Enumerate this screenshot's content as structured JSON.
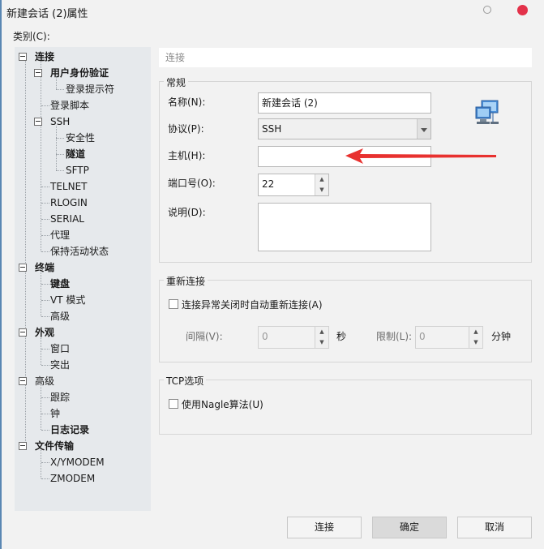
{
  "window": {
    "title": "新建会话 (2)属性"
  },
  "category_label": "类别(C):",
  "tree": [
    {
      "label": "连接",
      "bold": true,
      "level": 0,
      "expander": true
    },
    {
      "label": "用户身份验证",
      "bold": true,
      "level": 1,
      "expander": true
    },
    {
      "label": "登录提示符",
      "bold": false,
      "level": 2,
      "expander": false
    },
    {
      "label": "登录脚本",
      "bold": false,
      "level": 1,
      "expander": false
    },
    {
      "label": "SSH",
      "bold": false,
      "level": 1,
      "expander": true
    },
    {
      "label": "安全性",
      "bold": false,
      "level": 2,
      "expander": false
    },
    {
      "label": "隧道",
      "bold": true,
      "level": 2,
      "expander": false
    },
    {
      "label": "SFTP",
      "bold": false,
      "level": 2,
      "expander": false
    },
    {
      "label": "TELNET",
      "bold": false,
      "level": 1,
      "expander": false
    },
    {
      "label": "RLOGIN",
      "bold": false,
      "level": 1,
      "expander": false
    },
    {
      "label": "SERIAL",
      "bold": false,
      "level": 1,
      "expander": false
    },
    {
      "label": "代理",
      "bold": false,
      "level": 1,
      "expander": false
    },
    {
      "label": "保持活动状态",
      "bold": false,
      "level": 1,
      "expander": false
    },
    {
      "label": "终端",
      "bold": true,
      "level": 0,
      "expander": true
    },
    {
      "label": "键盘",
      "bold": true,
      "level": 1,
      "expander": false
    },
    {
      "label": "VT 模式",
      "bold": false,
      "level": 1,
      "expander": false
    },
    {
      "label": "高级",
      "bold": false,
      "level": 1,
      "expander": false
    },
    {
      "label": "外观",
      "bold": true,
      "level": 0,
      "expander": true
    },
    {
      "label": "窗口",
      "bold": false,
      "level": 1,
      "expander": false
    },
    {
      "label": "突出",
      "bold": false,
      "level": 1,
      "expander": false
    },
    {
      "label": "高级",
      "bold": false,
      "level": 0,
      "expander": true
    },
    {
      "label": "跟踪",
      "bold": false,
      "level": 1,
      "expander": false
    },
    {
      "label": "钟",
      "bold": false,
      "level": 1,
      "expander": false
    },
    {
      "label": "日志记录",
      "bold": true,
      "level": 1,
      "expander": false
    },
    {
      "label": "文件传输",
      "bold": true,
      "level": 0,
      "expander": true
    },
    {
      "label": "X/YMODEM",
      "bold": false,
      "level": 1,
      "expander": false
    },
    {
      "label": "ZMODEM",
      "bold": false,
      "level": 1,
      "expander": false
    }
  ],
  "breadcrumb": "连接",
  "general": {
    "title": "常规",
    "name_label": "名称(N):",
    "name_value": "新建会话 (2)",
    "protocol_label": "协议(P):",
    "protocol_value": "SSH",
    "host_label": "主机(H):",
    "host_value": "",
    "port_label": "端口号(O):",
    "port_value": "22",
    "desc_label": "说明(D):",
    "desc_value": ""
  },
  "reconnect": {
    "title": "重新连接",
    "checkbox_label": "连接异常关闭时自动重新连接(A)",
    "interval_label": "间隔(V):",
    "interval_value": "0",
    "sec_label": "秒",
    "limit_label": "限制(L):",
    "limit_value": "0",
    "min_label": "分钟"
  },
  "tcp": {
    "title": "TCP选项",
    "nagle_label": "使用Nagle算法(U)"
  },
  "buttons": {
    "connect": "连接",
    "ok": "确定",
    "cancel": "取消"
  },
  "colors": {
    "arrow": "#e8312f",
    "close": "#e3324a",
    "tree_bg": "#e6e9ec"
  }
}
